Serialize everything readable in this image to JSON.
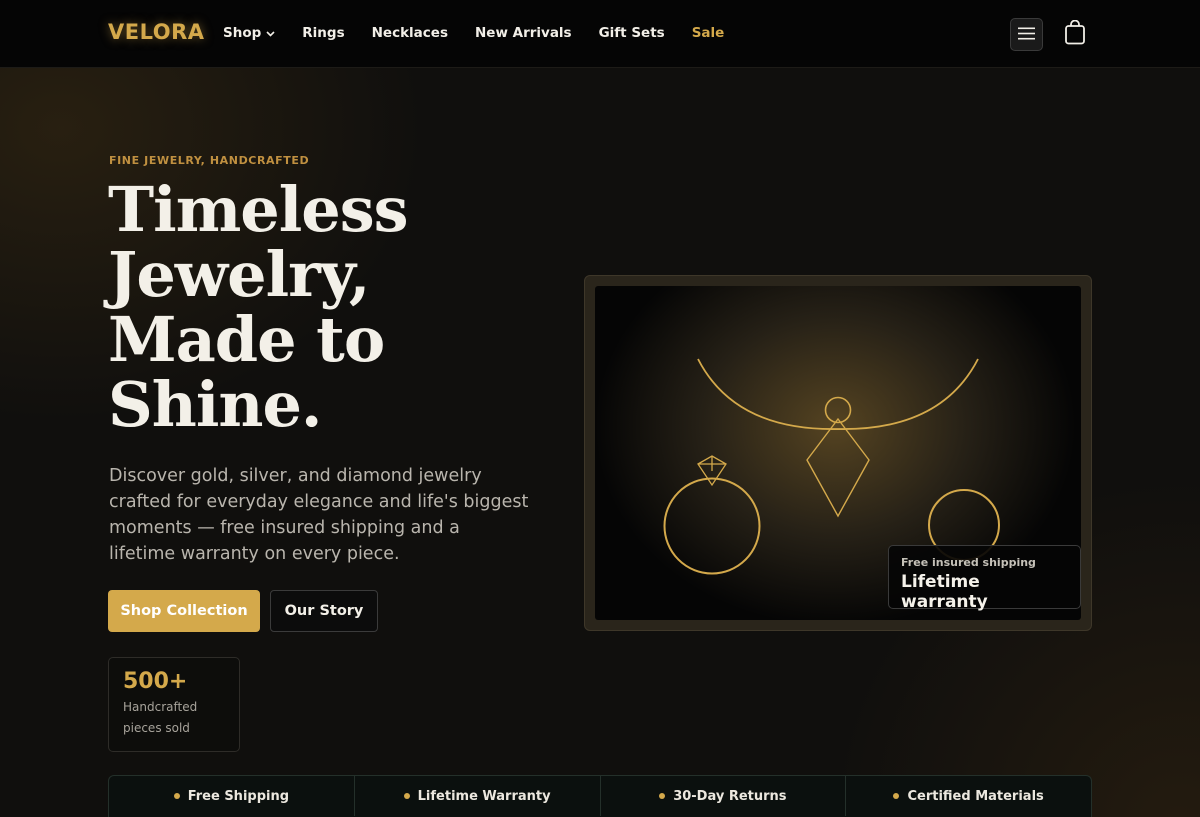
{
  "brand": "VELORA",
  "nav": {
    "links": [
      {
        "label": "Shop",
        "has_dropdown": true
      },
      {
        "label": "Rings"
      },
      {
        "label": "Necklaces"
      },
      {
        "label": "New Arrivals"
      },
      {
        "label": "Gift Sets"
      },
      {
        "label": "Sale",
        "highlight": true
      }
    ],
    "menu_icon": "hamburger-icon",
    "cart_icon": "shopping-bag-icon"
  },
  "hero": {
    "eyebrow": "FINE JEWELRY, HANDCRAFTED",
    "headline": "Timeless Jewelry, Made to Shine.",
    "subcopy": "Discover gold, silver, and diamond jewelry crafted for everyday elegance and life's biggest moments — free insured shipping and a lifetime warranty on every piece.",
    "primary_cta": "Shop Collection",
    "secondary_cta": "Our Story",
    "stat": {
      "value": "500+",
      "label": "Handcrafted pieces sold"
    }
  },
  "showcase": {
    "badge_small": "Free insured shipping",
    "badge_big": "Lifetime warranty",
    "illustration_icons": [
      "necklace-icon",
      "pendant-icon",
      "diamond-ring-icon",
      "ring-icon"
    ]
  },
  "features": [
    "Free Shipping",
    "Lifetime Warranty",
    "30-Day Returns",
    "Certified Materials"
  ],
  "colors": {
    "accent_gold": "#d4a94b",
    "background": "#0e0d0b",
    "nav_background": "#050505",
    "text_primary": "#f2efe8",
    "text_muted": "#b9b5ad"
  }
}
